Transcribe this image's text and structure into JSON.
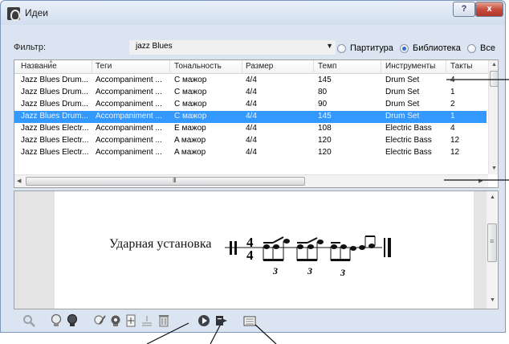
{
  "window": {
    "title": "Идеи",
    "help_label": "?",
    "close_label": "x"
  },
  "filter": {
    "label": "Фильтр:",
    "value": "jazz Blues",
    "dropdown_arrow": "▼",
    "options": [
      {
        "label": "Партитура",
        "selected": false
      },
      {
        "label": "Библиотека",
        "selected": true
      },
      {
        "label": "Все",
        "selected": false
      }
    ]
  },
  "table": {
    "columns": [
      "Название",
      "Теги",
      "Тональность",
      "Размер",
      "Темп",
      "Инструменты",
      "Такты"
    ],
    "rows": [
      [
        "Jazz Blues Drum...",
        "Accompaniment ...",
        "C мажор",
        "4/4",
        "145",
        "Drum Set",
        "4"
      ],
      [
        "Jazz Blues Drum...",
        "Accompaniment ...",
        "C мажор",
        "4/4",
        "80",
        "Drum Set",
        "1"
      ],
      [
        "Jazz Blues Drum...",
        "Accompaniment ...",
        "C мажор",
        "4/4",
        "90",
        "Drum Set",
        "2"
      ],
      [
        "Jazz Blues Drum...",
        "Accompaniment ...",
        "C мажор",
        "4/4",
        "145",
        "Drum Set",
        "1"
      ],
      [
        "Jazz Blues Electr...",
        "Accompaniment ...",
        "E мажор",
        "4/4",
        "108",
        "Electric Bass",
        "4"
      ],
      [
        "Jazz Blues Electr...",
        "Accompaniment ...",
        "A мажор",
        "4/4",
        "120",
        "Electric Bass",
        "12"
      ],
      [
        "Jazz Blues Electr...",
        "Accompaniment ...",
        "A мажор",
        "4/4",
        "120",
        "Electric Bass",
        "12"
      ]
    ],
    "selected_row": 3,
    "scroll_grip": "III"
  },
  "preview": {
    "instrument_label": "Ударная установка",
    "time_signature": {
      "top": "4",
      "bottom": "4"
    },
    "triplet_labels": [
      "3",
      "3",
      "3"
    ],
    "scroll_grip": "≡"
  },
  "toolbar": {
    "icons": [
      "magnifier-icon",
      "lightbulb-icon",
      "lightbulb-dark-icon",
      "edit-idea-icon",
      "idea-settings-icon",
      "new-idea-icon",
      "capture-icon",
      "delete-icon",
      "play-icon",
      "paste-idea-icon",
      "score-preview-icon"
    ]
  },
  "colors": {
    "selection": "#3399ff",
    "window_frame": "#dbe5f1",
    "close_button": "#c4493a"
  }
}
